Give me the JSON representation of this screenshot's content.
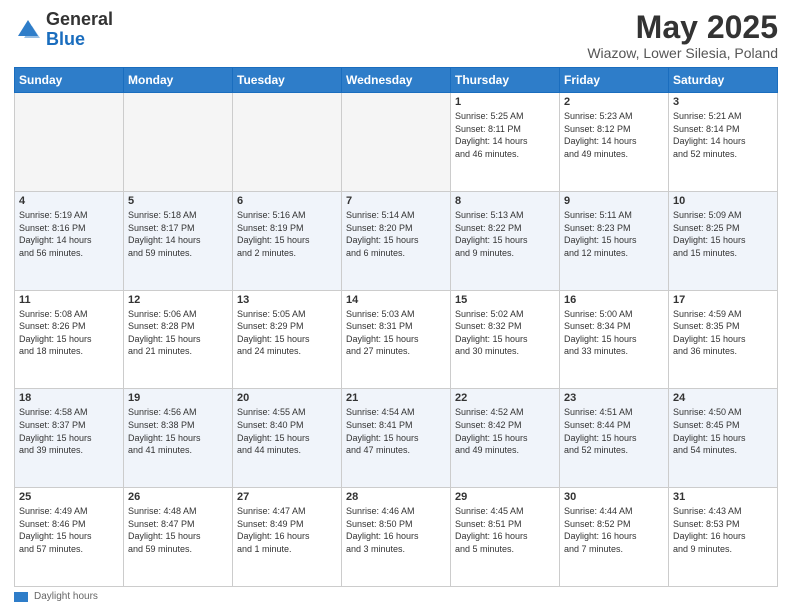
{
  "header": {
    "logo_general": "General",
    "logo_blue": "Blue",
    "title": "May 2025",
    "subtitle": "Wiazow, Lower Silesia, Poland"
  },
  "days_of_week": [
    "Sunday",
    "Monday",
    "Tuesday",
    "Wednesday",
    "Thursday",
    "Friday",
    "Saturday"
  ],
  "weeks": [
    [
      {
        "day": "",
        "info": ""
      },
      {
        "day": "",
        "info": ""
      },
      {
        "day": "",
        "info": ""
      },
      {
        "day": "",
        "info": ""
      },
      {
        "day": "1",
        "info": "Sunrise: 5:25 AM\nSunset: 8:11 PM\nDaylight: 14 hours\nand 46 minutes."
      },
      {
        "day": "2",
        "info": "Sunrise: 5:23 AM\nSunset: 8:12 PM\nDaylight: 14 hours\nand 49 minutes."
      },
      {
        "day": "3",
        "info": "Sunrise: 5:21 AM\nSunset: 8:14 PM\nDaylight: 14 hours\nand 52 minutes."
      }
    ],
    [
      {
        "day": "4",
        "info": "Sunrise: 5:19 AM\nSunset: 8:16 PM\nDaylight: 14 hours\nand 56 minutes."
      },
      {
        "day": "5",
        "info": "Sunrise: 5:18 AM\nSunset: 8:17 PM\nDaylight: 14 hours\nand 59 minutes."
      },
      {
        "day": "6",
        "info": "Sunrise: 5:16 AM\nSunset: 8:19 PM\nDaylight: 15 hours\nand 2 minutes."
      },
      {
        "day": "7",
        "info": "Sunrise: 5:14 AM\nSunset: 8:20 PM\nDaylight: 15 hours\nand 6 minutes."
      },
      {
        "day": "8",
        "info": "Sunrise: 5:13 AM\nSunset: 8:22 PM\nDaylight: 15 hours\nand 9 minutes."
      },
      {
        "day": "9",
        "info": "Sunrise: 5:11 AM\nSunset: 8:23 PM\nDaylight: 15 hours\nand 12 minutes."
      },
      {
        "day": "10",
        "info": "Sunrise: 5:09 AM\nSunset: 8:25 PM\nDaylight: 15 hours\nand 15 minutes."
      }
    ],
    [
      {
        "day": "11",
        "info": "Sunrise: 5:08 AM\nSunset: 8:26 PM\nDaylight: 15 hours\nand 18 minutes."
      },
      {
        "day": "12",
        "info": "Sunrise: 5:06 AM\nSunset: 8:28 PM\nDaylight: 15 hours\nand 21 minutes."
      },
      {
        "day": "13",
        "info": "Sunrise: 5:05 AM\nSunset: 8:29 PM\nDaylight: 15 hours\nand 24 minutes."
      },
      {
        "day": "14",
        "info": "Sunrise: 5:03 AM\nSunset: 8:31 PM\nDaylight: 15 hours\nand 27 minutes."
      },
      {
        "day": "15",
        "info": "Sunrise: 5:02 AM\nSunset: 8:32 PM\nDaylight: 15 hours\nand 30 minutes."
      },
      {
        "day": "16",
        "info": "Sunrise: 5:00 AM\nSunset: 8:34 PM\nDaylight: 15 hours\nand 33 minutes."
      },
      {
        "day": "17",
        "info": "Sunrise: 4:59 AM\nSunset: 8:35 PM\nDaylight: 15 hours\nand 36 minutes."
      }
    ],
    [
      {
        "day": "18",
        "info": "Sunrise: 4:58 AM\nSunset: 8:37 PM\nDaylight: 15 hours\nand 39 minutes."
      },
      {
        "day": "19",
        "info": "Sunrise: 4:56 AM\nSunset: 8:38 PM\nDaylight: 15 hours\nand 41 minutes."
      },
      {
        "day": "20",
        "info": "Sunrise: 4:55 AM\nSunset: 8:40 PM\nDaylight: 15 hours\nand 44 minutes."
      },
      {
        "day": "21",
        "info": "Sunrise: 4:54 AM\nSunset: 8:41 PM\nDaylight: 15 hours\nand 47 minutes."
      },
      {
        "day": "22",
        "info": "Sunrise: 4:52 AM\nSunset: 8:42 PM\nDaylight: 15 hours\nand 49 minutes."
      },
      {
        "day": "23",
        "info": "Sunrise: 4:51 AM\nSunset: 8:44 PM\nDaylight: 15 hours\nand 52 minutes."
      },
      {
        "day": "24",
        "info": "Sunrise: 4:50 AM\nSunset: 8:45 PM\nDaylight: 15 hours\nand 54 minutes."
      }
    ],
    [
      {
        "day": "25",
        "info": "Sunrise: 4:49 AM\nSunset: 8:46 PM\nDaylight: 15 hours\nand 57 minutes."
      },
      {
        "day": "26",
        "info": "Sunrise: 4:48 AM\nSunset: 8:47 PM\nDaylight: 15 hours\nand 59 minutes."
      },
      {
        "day": "27",
        "info": "Sunrise: 4:47 AM\nSunset: 8:49 PM\nDaylight: 16 hours\nand 1 minute."
      },
      {
        "day": "28",
        "info": "Sunrise: 4:46 AM\nSunset: 8:50 PM\nDaylight: 16 hours\nand 3 minutes."
      },
      {
        "day": "29",
        "info": "Sunrise: 4:45 AM\nSunset: 8:51 PM\nDaylight: 16 hours\nand 5 minutes."
      },
      {
        "day": "30",
        "info": "Sunrise: 4:44 AM\nSunset: 8:52 PM\nDaylight: 16 hours\nand 7 minutes."
      },
      {
        "day": "31",
        "info": "Sunrise: 4:43 AM\nSunset: 8:53 PM\nDaylight: 16 hours\nand 9 minutes."
      }
    ]
  ],
  "footer": {
    "daylight_label": "Daylight hours"
  }
}
